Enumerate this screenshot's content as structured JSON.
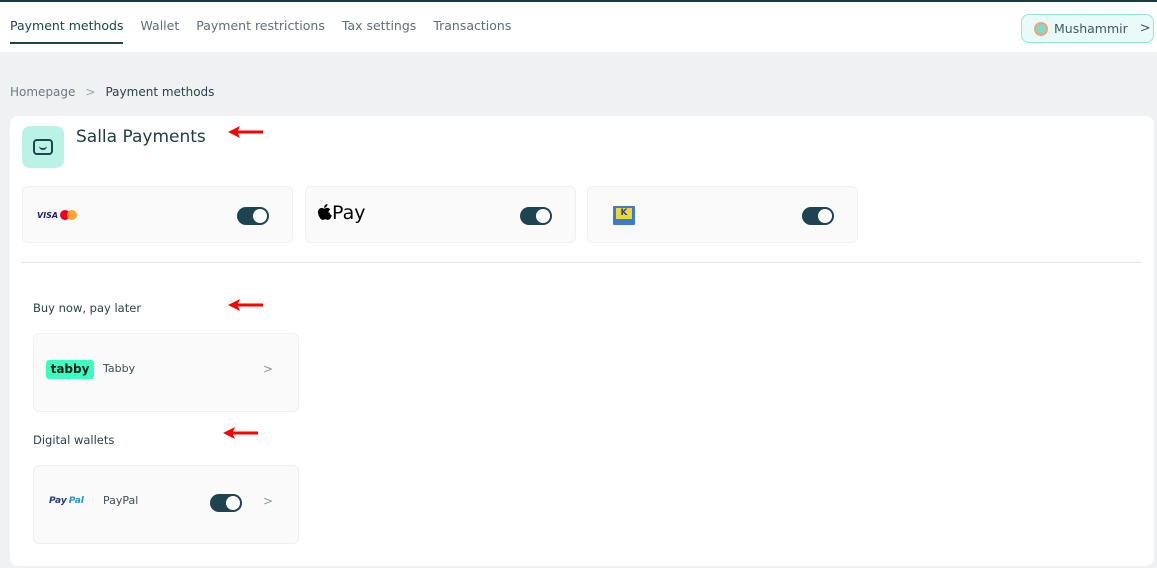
{
  "nav": {
    "tabs": [
      "Payment methods",
      "Wallet",
      "Payment restrictions",
      "Tax settings",
      "Transactions"
    ],
    "active_tab": "Payment methods"
  },
  "user": {
    "name": "Mushammir",
    "chevron": ">"
  },
  "breadcrumb": {
    "home": "Homepage",
    "separator": ">",
    "current": "Payment methods"
  },
  "salla": {
    "title": "Salla Payments",
    "methods": [
      {
        "icon": "visa-mastercard-logo",
        "visa_text": "VISA",
        "enabled": true
      },
      {
        "icon": "apple-pay-logo",
        "label": "Pay",
        "enabled": true
      },
      {
        "icon": "knet-logo",
        "label": "K",
        "enabled": true
      }
    ]
  },
  "bnpl": {
    "title": "Buy now, pay later",
    "providers": [
      {
        "logo_text": "tabby",
        "name": "Tabby",
        "chevron": ">"
      }
    ]
  },
  "wallets": {
    "title": "Digital wallets",
    "providers": [
      {
        "logo_text_1": "Pay",
        "logo_text_2": "Pal",
        "name": "PayPal",
        "enabled": true,
        "chevron": ">"
      }
    ]
  },
  "colors": {
    "accent": "#1d4450",
    "brand_mint": "#b8f3e6",
    "annotation_arrow": "#ff0000"
  }
}
